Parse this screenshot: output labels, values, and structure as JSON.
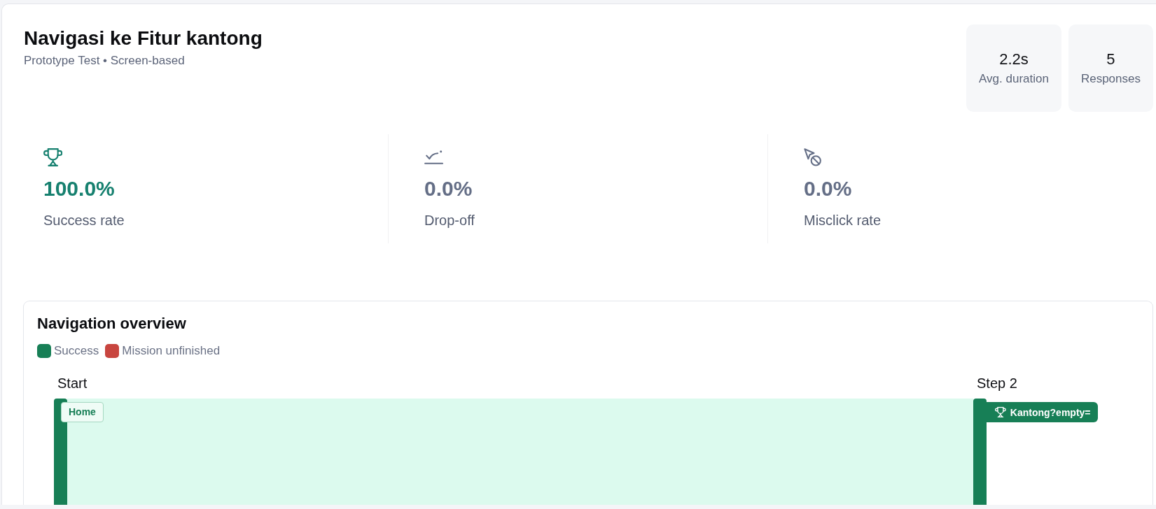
{
  "header": {
    "title": "Navigasi ke Fitur kantong",
    "subtitle": "Prototype Test • Screen-based"
  },
  "summary": [
    {
      "value": "2.2s",
      "label": "Avg. duration"
    },
    {
      "value": "5",
      "label": "Responses"
    }
  ],
  "metrics": [
    {
      "kind": "success",
      "value": "100.0%",
      "label": "Success rate"
    },
    {
      "kind": "drop_off",
      "value": "0.0%",
      "label": "Drop-off"
    },
    {
      "kind": "misclick",
      "value": "0.0%",
      "label": "Misclick rate"
    }
  ],
  "navigation_overview": {
    "title": "Navigation overview",
    "legend": [
      {
        "label": "Success",
        "color": "#177f56"
      },
      {
        "label": "Mission unfinished",
        "color": "#c8453f"
      }
    ],
    "steps": [
      {
        "label": "Start",
        "screens": [
          {
            "kind": "screen",
            "name": "Home"
          }
        ]
      },
      {
        "label": "Step 2",
        "screens": [
          {
            "kind": "goal",
            "name": "Kantong?empty="
          }
        ]
      }
    ]
  }
}
